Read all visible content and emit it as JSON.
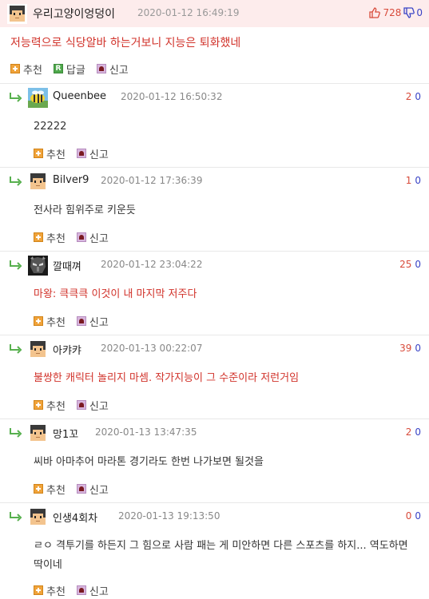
{
  "post": {
    "author": "우리고양이엉덩이",
    "date": "2020-01-12 16:49:19",
    "up_count": "728",
    "down_count": "0",
    "title": "저능력으로 식당알바 하는거보니 지능은 퇴화했네",
    "actions": {
      "recommend": "추천",
      "reply": "답글",
      "report": "신고",
      "reply_icon": "R"
    }
  },
  "comment_actions": {
    "recommend": "추천",
    "report": "신고"
  },
  "comments": [
    {
      "author": "Queenbee",
      "date": "2020-01-12 16:50:32",
      "up": "2",
      "down": "0",
      "body": "22222"
    },
    {
      "author": "Bilver9",
      "date": "2020-01-12 17:36:39",
      "up": "1",
      "down": "0",
      "body": "전사라 힘위주로 키운듯"
    },
    {
      "author": "깔때껴",
      "date": "2020-01-12 23:04:22",
      "up": "25",
      "down": "0",
      "body": "마왕: 큭큭큭 이것이 내 마지막 저주다"
    },
    {
      "author": "아캬캬",
      "date": "2020-01-13 00:22:07",
      "up": "39",
      "down": "0",
      "body": "불쌍한 캐릭터 놀리지 마셈. 작가지능이 그 수준이라 저런거임"
    },
    {
      "author": "망1꼬",
      "date": "2020-01-13 13:47:35",
      "up": "2",
      "down": "0",
      "body": "씨바 아마추어 마라톤 경기라도 한번 나가보면 될것을"
    },
    {
      "author": "인생4회차",
      "date": "2020-01-13 19:13:50",
      "up": "0",
      "down": "0",
      "body": "ㄹㅇ 격투기를 하든지 그 힘으로 사람 패는 게 미안하면 다른 스포츠를 하지... 역도하면 딱이네"
    }
  ],
  "colors": {
    "header_bg": "#fdecec",
    "accent_red": "#d1322a",
    "vote_up": "#d84b3b",
    "vote_down": "#3a44c6",
    "recommend_icon": "#f0a33a",
    "reply_icon": "#4ea84b",
    "report_icon": "#d8b6de"
  },
  "icons": {
    "reply_arrow": "reply-arrow-icon",
    "thumbs_up": "thumbs-up-icon",
    "thumbs_down": "thumbs-down-icon",
    "recommend": "plus-box-icon",
    "reply": "reply-r-icon",
    "report": "alarm-bell-icon",
    "avatar_default": "pixel-face-avatar",
    "avatar_queenbee": "pixel-bee-avatar",
    "avatar_knight": "dark-knight-avatar"
  }
}
